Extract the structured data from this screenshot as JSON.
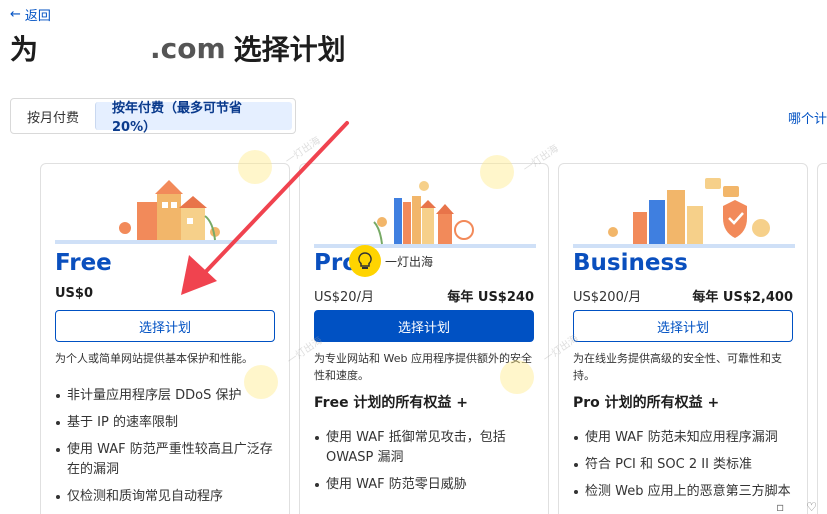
{
  "header": {
    "back_label": "返回",
    "title_prefix": "为",
    "title_domain": ".com",
    "title_suffix": "选择计划"
  },
  "billing": {
    "monthly_label": "按月付费",
    "annual_label": "按年付费（最多可节省 20%）",
    "selected": "annual"
  },
  "compare_link": "哪个计",
  "plans": [
    {
      "name": "Free",
      "price_monthly": "US$0",
      "price_annual": "",
      "button": "选择计划",
      "primary": false,
      "description": "为个人或简单网站提供基本保护和性能。",
      "includes": "",
      "features": [
        "非计量应用程序层 DDoS 保护",
        "基于 IP 的速率限制",
        "使用 WAF 防范严重性较高且广泛存在的漏洞",
        "仅检测和质询常见自动程序"
      ]
    },
    {
      "name": "Pro",
      "price_monthly": "US$20/月",
      "price_annual": "每年 US$240",
      "button": "选择计划",
      "primary": true,
      "description": "为专业网站和 Web 应用程序提供额外的安全性和速度。",
      "includes": "Free 计划的所有权益 +",
      "features": [
        "使用 WAF 抵御常见攻击，包括 OWASP 漏洞",
        "使用 WAF 防范零日威胁"
      ]
    },
    {
      "name": "Business",
      "price_monthly": "US$200/月",
      "price_annual": "每年 US$2,400",
      "button": "选择计划",
      "primary": false,
      "description": "为在线业务提供高级的安全性、可靠性和支持。",
      "includes": "Pro 计划的所有权益 +",
      "features": [
        "使用 WAF 防范未知应用程序漏洞",
        "符合 PCI 和 SOC 2 II 类标准",
        "检测 Web 应用上的恶意第三方脚本"
      ]
    }
  ],
  "watermark_text": "一灯出海",
  "colors": {
    "accent": "#0051c3",
    "plan_name": "#0a4fbe",
    "toggle_selected_bg": "#e5efff",
    "arrow": "#f0434f"
  }
}
